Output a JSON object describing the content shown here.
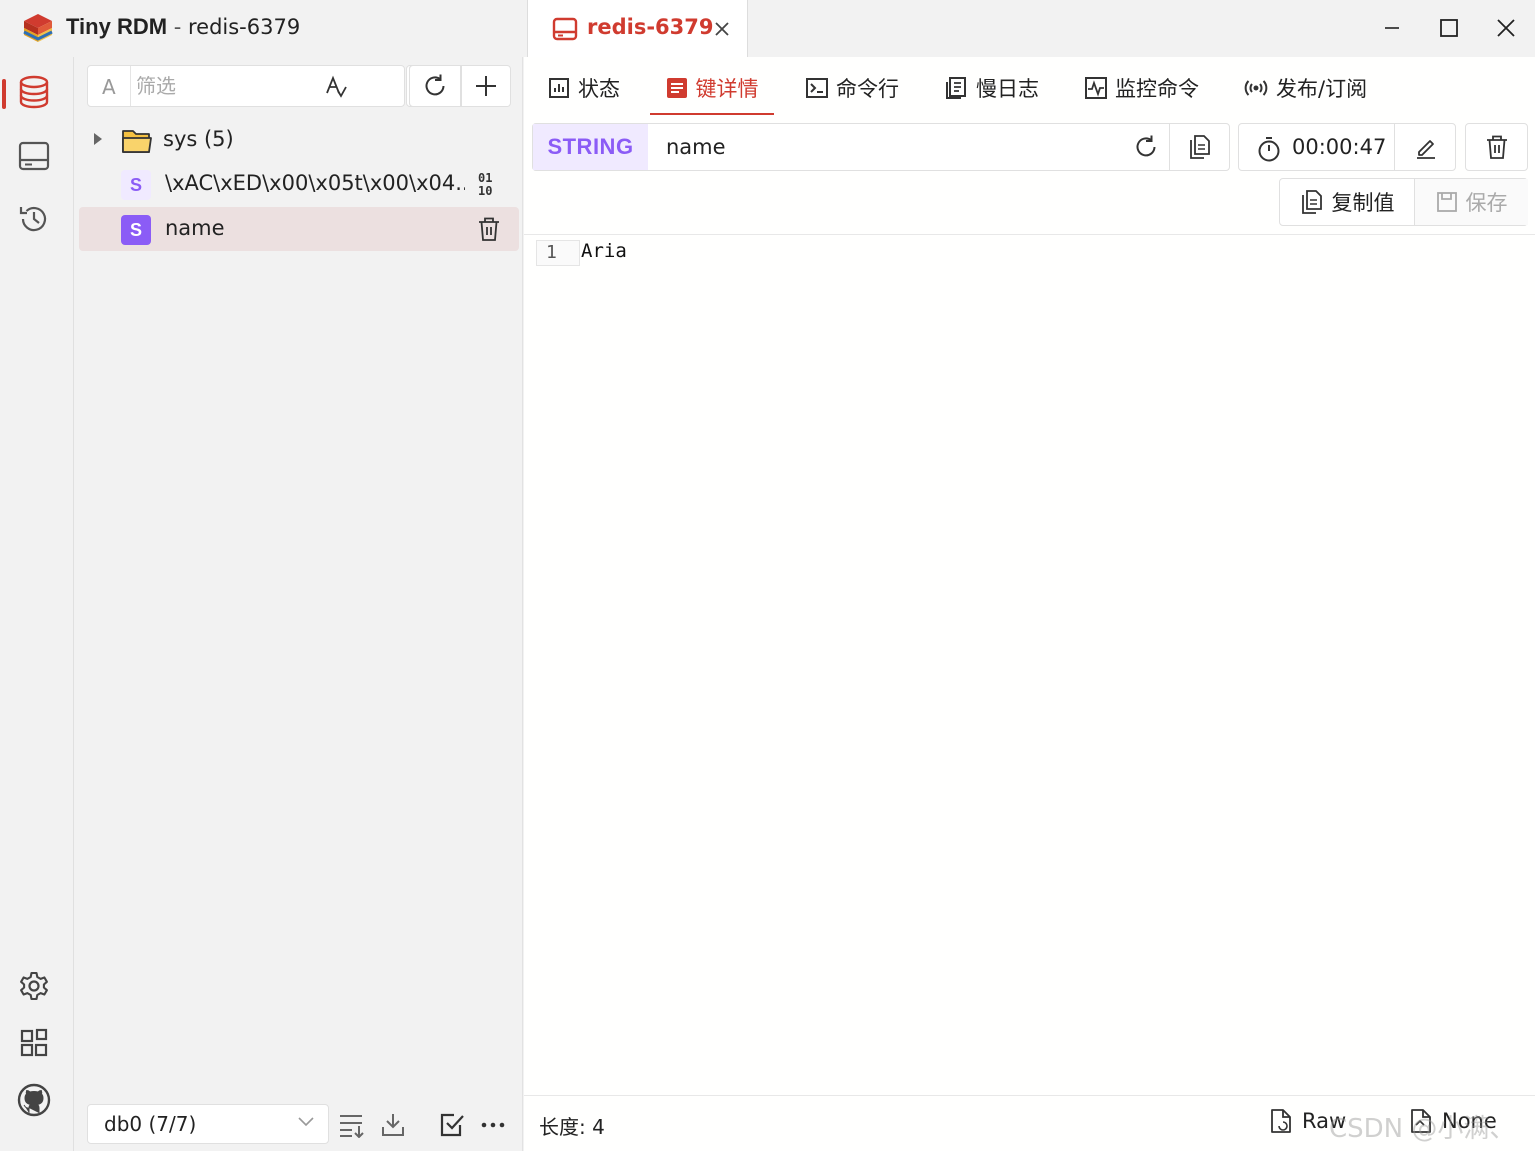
{
  "app": {
    "name": "Tiny RDM",
    "separator": " - ",
    "connection": "redis-6379"
  },
  "conn_tab": {
    "label": "redis-6379"
  },
  "window_controls": [
    "minimize",
    "maximize",
    "close"
  ],
  "rail": {
    "top_icons": [
      "database-icon",
      "terminal-panel-icon",
      "history-icon"
    ],
    "bottom_icons": [
      "settings-icon",
      "apps-grid-icon",
      "github-icon"
    ],
    "accent_color": "#d03b2f"
  },
  "tree": {
    "filter_prefix": "A",
    "filter_placeholder": "筛选",
    "items": [
      {
        "label": "sys (5)",
        "type": "folder"
      },
      {
        "label": "\\xAC\\xED\\x00\\x05t\\x00\\x04...",
        "type": "string",
        "badge": "S"
      },
      {
        "label": "name",
        "type": "string",
        "badge": "S",
        "selected": true
      }
    ],
    "db_select": "db0 (7/7)"
  },
  "subtabs": [
    "状态",
    "键详情",
    "命令行",
    "慢日志",
    "监控命令",
    "发布/订阅"
  ],
  "active_subtab": "键详情",
  "key_detail": {
    "type": "STRING",
    "type_color": "#8b5cf6",
    "key_name": "name",
    "ttl": "00:00:47",
    "copy_value_label": "复制值",
    "save_label": "保存",
    "line_number": "1",
    "value": "Aria"
  },
  "status_bar": {
    "length_label": "长度: 4",
    "view_mode": "Raw",
    "decode_mode": "None",
    "watermark": "CSDN @小满、"
  }
}
